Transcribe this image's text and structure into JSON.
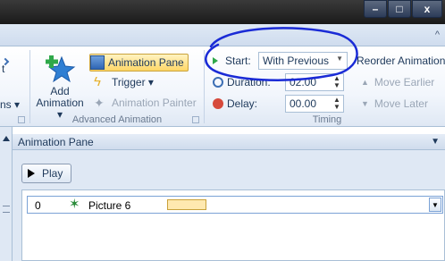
{
  "window": {
    "minimize_label": "–",
    "maximize_label": "□",
    "close_label": "x"
  },
  "ribbon": {
    "collapse_icon": "^",
    "partial_left_labels": [
      "t",
      "ns ▾"
    ],
    "add_animation": {
      "label_line1": "Add",
      "label_line2": "Animation ▾",
      "icon": "add-animation-star-icon"
    },
    "animation_pane_button": "Animation Pane",
    "trigger_button": "Trigger ▾",
    "animation_painter_button": "Animation Painter",
    "advanced_animation_group": "Advanced Animation",
    "start_label": "Start:",
    "start_value": "With Previous",
    "duration_label": "Duration:",
    "duration_value": "02.00",
    "delay_label": "Delay:",
    "delay_value": "00.00",
    "timing_group": "Timing",
    "reorder_label": "Reorder Animation",
    "move_earlier": "Move Earlier",
    "move_later": "Move Later"
  },
  "pane": {
    "title": "Animation Pane",
    "play_button": "Play",
    "items": [
      {
        "order": "0",
        "name": "Picture 6"
      }
    ]
  },
  "colors": {
    "accent_highlight": "#ffd767",
    "annotation_ink": "#1a2bd6",
    "timeline_bar": "#ffe9b0"
  }
}
